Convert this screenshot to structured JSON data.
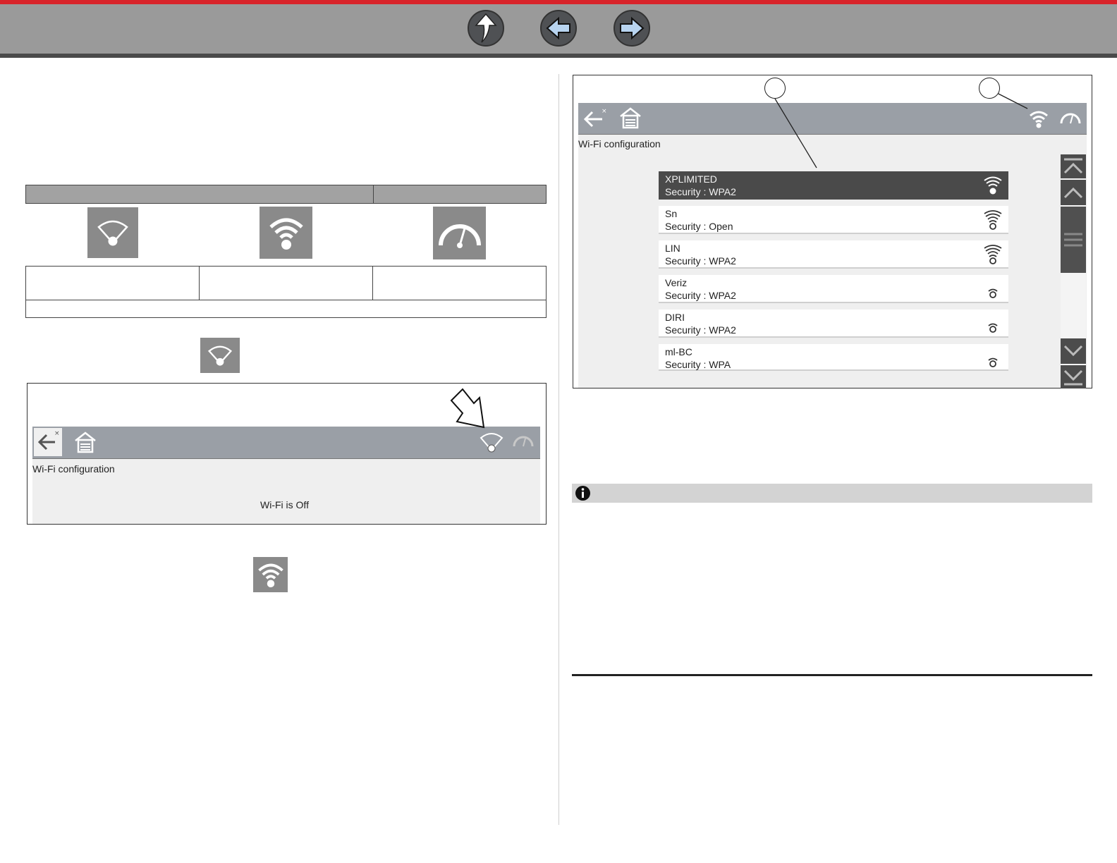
{
  "nav": {
    "up_icon": "up-arrow-icon",
    "back_icon": "left-arrow-icon",
    "forward_icon": "right-arrow-icon"
  },
  "icons": {
    "wifi_off": "wifi-off-icon",
    "wifi_connected": "wifi-connected-icon",
    "gauge": "gauge-icon"
  },
  "wifi_off_screen": {
    "title": "Wi-Fi configuration",
    "status": "Wi-Fi is Off"
  },
  "wifi_list_screen": {
    "title": "Wi-Fi configuration",
    "networks": [
      {
        "name": "XPLIMITED",
        "security": "Security : WPA2",
        "selected": true
      },
      {
        "name": "Sn",
        "security": "Security : Open",
        "selected": false
      },
      {
        "name": "LIN",
        "security": "Security : WPA2",
        "selected": false
      },
      {
        "name": "Veriz",
        "security": "Security : WPA2",
        "selected": false
      },
      {
        "name": "DIRI",
        "security": "Security : WPA2",
        "selected": false
      },
      {
        "name": "ml-BC",
        "security": "Security : WPA",
        "selected": false
      }
    ]
  },
  "colors": {
    "accent_red": "#d8232a",
    "toolbar_gray": "#9a9fa6",
    "tile_gray": "#8a8a8a",
    "selected_row": "#4a4a4a"
  }
}
